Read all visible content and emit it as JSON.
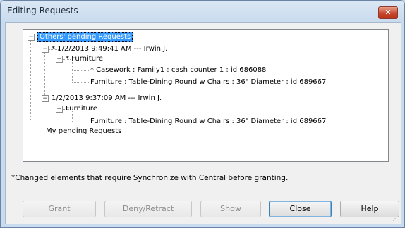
{
  "window": {
    "title": "Editing Requests",
    "close_glyph": "✕"
  },
  "tree": {
    "root1": "Others' pending Requests",
    "req1_header": "* 1/2/2013 9:49:41 AM --- Irwin J.",
    "req1_cat": "* Furniture",
    "req1_item1": "* Casework : Family1 : cash counter 1 : id 686088",
    "req1_item2": "Furniture : Table-Dining Round w Chairs : 36\" Diameter : id 689667",
    "req2_header": "1/2/2013 9:37:09 AM --- Irwin J.",
    "req2_cat": "Furniture",
    "req2_item1": "Furniture : Table-Dining Round w Chairs : 36\" Diameter : id 689667",
    "root2": "My pending Requests"
  },
  "note": "*Changed elements that require Synchronize with Central before granting.",
  "buttons": {
    "grant": "Grant",
    "deny": "Deny/Retract",
    "show": "Show",
    "close": "Close",
    "help": "Help"
  },
  "colors": {
    "selection": "#3399ff",
    "title_bar": "#dbe7f4"
  }
}
